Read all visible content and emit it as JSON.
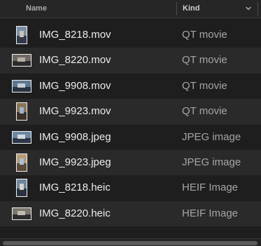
{
  "header": {
    "name_label": "Name",
    "kind_label": "Kind",
    "sort_icon": "chevron-down-icon"
  },
  "files": [
    {
      "name": "IMG_8218.mov",
      "kind": "QT movie",
      "thumb": "video-thumbnail-portrait",
      "palette": [
        "#7a8fa8",
        "#2f3a4a",
        "#c9c2b8"
      ]
    },
    {
      "name": "IMG_8220.mov",
      "kind": "QT movie",
      "thumb": "video-thumbnail-landscape",
      "palette": [
        "#6f6a63",
        "#2b2b2b",
        "#b5aea2"
      ]
    },
    {
      "name": "IMG_9908.mov",
      "kind": "QT movie",
      "thumb": "video-thumbnail-landscape",
      "palette": [
        "#5f7891",
        "#283442",
        "#c5cdd6"
      ]
    },
    {
      "name": "IMG_9923.mov",
      "kind": "QT movie",
      "thumb": "video-thumbnail-portrait",
      "palette": [
        "#8a7457",
        "#3a3026",
        "#9bb4d1"
      ]
    },
    {
      "name": "IMG_9908.jpeg",
      "kind": "JPEG image",
      "thumb": "image-thumbnail-landscape",
      "palette": [
        "#6d87a3",
        "#2b3746",
        "#d3d8de"
      ]
    },
    {
      "name": "IMG_9923.jpeg",
      "kind": "JPEG image",
      "thumb": "image-thumbnail-portrait",
      "palette": [
        "#b69b74",
        "#5a4a38",
        "#a8c0da"
      ]
    },
    {
      "name": "IMG_8218.heic",
      "kind": "HEIF Image",
      "thumb": "image-thumbnail-portrait",
      "palette": [
        "#6e86a2",
        "#27313f",
        "#d7d2c9"
      ]
    },
    {
      "name": "IMG_8220.heic",
      "kind": "HEIF Image",
      "thumb": "image-thumbnail-landscape",
      "palette": [
        "#7c776e",
        "#2d2d2d",
        "#c2bbb0"
      ]
    }
  ]
}
